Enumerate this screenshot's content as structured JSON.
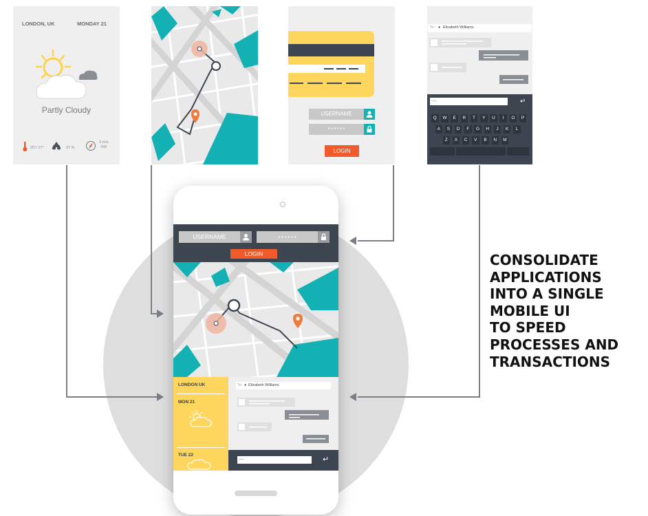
{
  "colors": {
    "teal": "#13b1b3",
    "orange": "#f15a2b",
    "yellow": "#fed65e",
    "dark": "#3c4550",
    "grey_bg": "#efefef",
    "circle": "#dcdcdc",
    "pin": "#f07a3c"
  },
  "weather_card": {
    "location": "LONDON, UK",
    "date": "MONDAY 21",
    "condition": "Partly Cloudy",
    "temp": "25°/ 17°",
    "humidity": "37 %",
    "wind_speed": "3 m/s",
    "wind_dir": "SW",
    "icons": [
      "sun-cloud-icon",
      "thermometer-icon",
      "humidity-icon",
      "compass-icon"
    ]
  },
  "login_card": {
    "username_placeholder": "USERNAME",
    "password_mask": "• • • • • •",
    "login_label": "LOGIN"
  },
  "message_card": {
    "to_label": "To:",
    "recipient": "Elizabeth Williams",
    "input_value": "....",
    "keyboard_rows": [
      [
        "Q",
        "W",
        "E",
        "R",
        "T",
        "Y",
        "U",
        "I",
        "O",
        "P"
      ],
      [
        "A",
        "S",
        "D",
        "F",
        "G",
        "H",
        "J",
        "K",
        "L"
      ],
      [
        "Z",
        "X",
        "C",
        "V",
        "B",
        "N",
        "M"
      ]
    ]
  },
  "phone": {
    "username_placeholder": "USERNAME",
    "password_mask": "• • • • • •",
    "login_label": "LOGIN",
    "weather_location": "LONDON  UK",
    "day1": "MON 21",
    "day2": "TUE 22",
    "to_label": "To:",
    "recipient": "Elizabeth Williams",
    "input_value": "...."
  },
  "headline": [
    "CONSOLIDATE",
    "APPLICATIONS",
    "INTO A SINGLE",
    "MOBILE UI",
    "TO SPEED",
    "PROCESSES AND",
    "TRANSACTIONS"
  ]
}
